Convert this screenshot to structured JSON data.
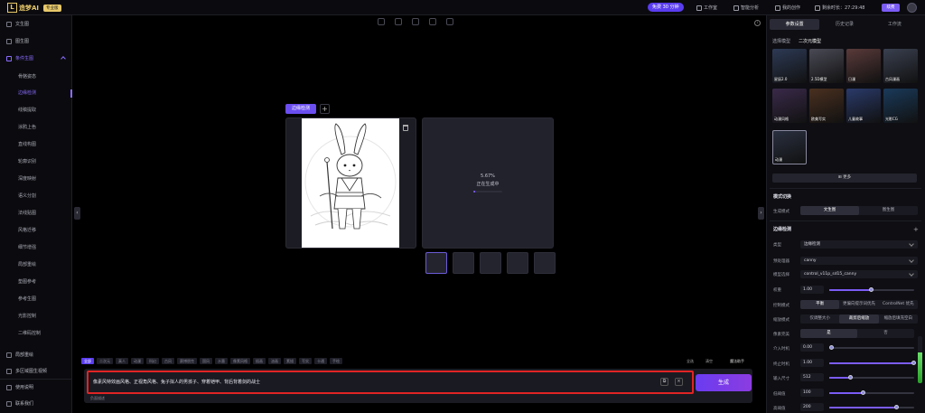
{
  "brand": {
    "logo_mark": "L",
    "name": "造梦AI",
    "badge": "专业版"
  },
  "topbar": {
    "promo": "免费 30 分钟",
    "items": [
      "工作室",
      "智能分析",
      "我的创作",
      "剩余时长：27:29:48"
    ],
    "cta": "续费"
  },
  "sidebar": {
    "items": [
      {
        "label": "文生图"
      },
      {
        "label": "图生图"
      },
      {
        "label": "条件生图"
      }
    ],
    "sub_items": [
      "骨骼姿态",
      "边缘检测",
      "线稿提取",
      "涂鸦上色",
      "直线构图",
      "轮廓识别",
      "深度映射",
      "语义分割",
      "法线贴图",
      "风格迁移",
      "细节增强",
      "局部重绘",
      "垫图参考",
      "参考生图",
      "光影控制",
      "二维码控制"
    ],
    "footer_items": [
      "局部重绘",
      "多区域图生视频",
      "使用说明",
      "联系我们"
    ]
  },
  "canvas": {
    "control_tab": "边缘检测",
    "add_symbol": "+",
    "progress_pct": "5.67%",
    "progress_fraction": 0.0567,
    "progress_text": "正在生成中",
    "info_symbol": "i"
  },
  "bottom": {
    "tags": [
      "全部",
      "二次元",
      "真人",
      "动漫",
      "科幻",
      "古风",
      "赛博朋克",
      "国风",
      "水墨",
      "像素风格",
      "插画",
      "油画",
      "素描",
      "写实",
      "卡通",
      "手绘"
    ],
    "tag_right": [
      "全选",
      "清空"
    ],
    "style_label": "魔法助手",
    "prompt": "像素风特效画风格、正视角风格、兔子拟人的男孩子、穿着铠甲、背后背着剑的战士",
    "negative_link": "负面描述",
    "generate": "生成",
    "copy_symbol": "⧉",
    "clear_symbol": "×"
  },
  "right": {
    "tabs": [
      "参数设置",
      "历史记录",
      "工作流"
    ],
    "model_label": "选择模型",
    "model_current": "二次元模型",
    "models": [
      "星辰2.0",
      "2.5D模型",
      "日漫",
      "古风漫画",
      "动漫风格",
      "欧美写实",
      "儿童故事",
      "光影CG",
      "动漫"
    ],
    "model_colors": [
      "#2d3a55",
      "#4a4a56",
      "#5a3a3a",
      "#3a4050",
      "#3a2a4a",
      "#4a3020",
      "#2a3a6a",
      "#1a3a5a",
      "#2a3040"
    ],
    "more": "更多",
    "mode_title": "模式切换",
    "mode_label": "生成模式",
    "mode_options": [
      "文生图",
      "图生图"
    ],
    "cn_title": "边缘检测",
    "add_symbol": "+",
    "rows": {
      "type": {
        "label": "类型",
        "value": "边缘检测"
      },
      "preprocessor": {
        "label": "预处理器",
        "value": "canny"
      },
      "model": {
        "label": "模型选择",
        "value": "control_v11p_sd15_canny"
      },
      "weight": {
        "label": "权重",
        "value": "1.00",
        "fraction": 0.5
      },
      "control_mode": {
        "label": "控制模式",
        "options": [
          "平衡",
          "更偏向提示词优先",
          "ControlNet 优先"
        ]
      },
      "resize": {
        "label": "缩放模式",
        "options": [
          "仅调整大小",
          "裁剪后缩放",
          "缩放后填充空白"
        ]
      },
      "pixel_perfect": {
        "label": "像素完美",
        "options": [
          "是",
          "否"
        ]
      },
      "start_step": {
        "label": "介入时机",
        "value": "0.00",
        "fraction": 0.0
      },
      "end_step": {
        "label": "终止时机",
        "value": "1.00",
        "fraction": 1.0
      },
      "resolution": {
        "label": "输入尺寸",
        "value": "512",
        "fraction": 0.25
      },
      "low_th": {
        "label": "低阈值",
        "value": "100",
        "fraction": 0.4
      },
      "high_th": {
        "label": "高阈值",
        "value": "200",
        "fraction": 0.8
      }
    },
    "bar_level": 0.65
  }
}
